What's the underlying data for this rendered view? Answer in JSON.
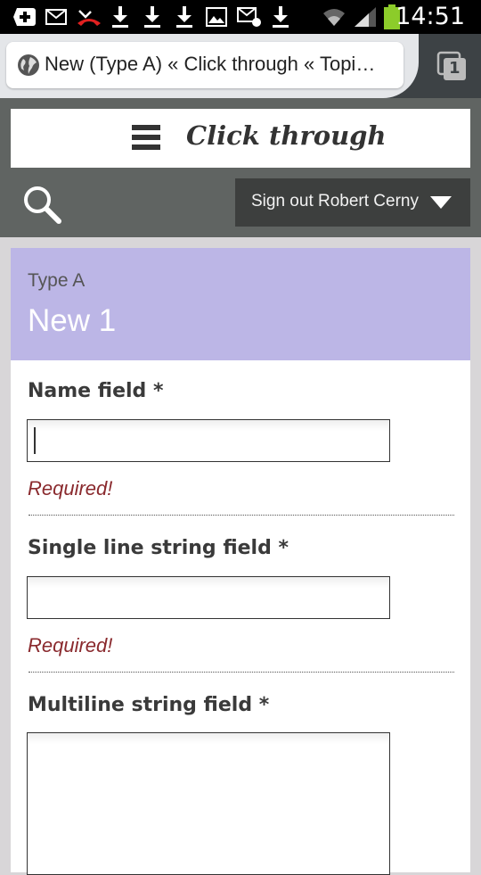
{
  "status_bar": {
    "time": "14:51",
    "icons": [
      "add-notification-icon",
      "mail-icon",
      "missed-call-icon",
      "download-icon",
      "download-icon",
      "download-icon",
      "image-icon",
      "email-sent-icon",
      "download-icon",
      "wifi-icon",
      "signal-icon",
      "battery-icon"
    ]
  },
  "browser": {
    "tab_title": "New (Type A) « Click through « Topi…",
    "tab_count": "1"
  },
  "site": {
    "title": "Click through",
    "signout_label": "Sign out Robert Cerny"
  },
  "panel": {
    "type_label": "Type A",
    "title": "New 1"
  },
  "form": {
    "name_field": {
      "label": "Name field *",
      "value": "",
      "error": "Required!"
    },
    "single_line_field": {
      "label": "Single line string field *",
      "value": "",
      "error": "Required!"
    },
    "multiline_field": {
      "label": "Multiline string field *",
      "value": ""
    }
  },
  "colors": {
    "header_bg": "#606462",
    "panel_head_bg": "#bcb6e6",
    "error": "#8a2a2e",
    "battery": "#8ccc2a"
  }
}
